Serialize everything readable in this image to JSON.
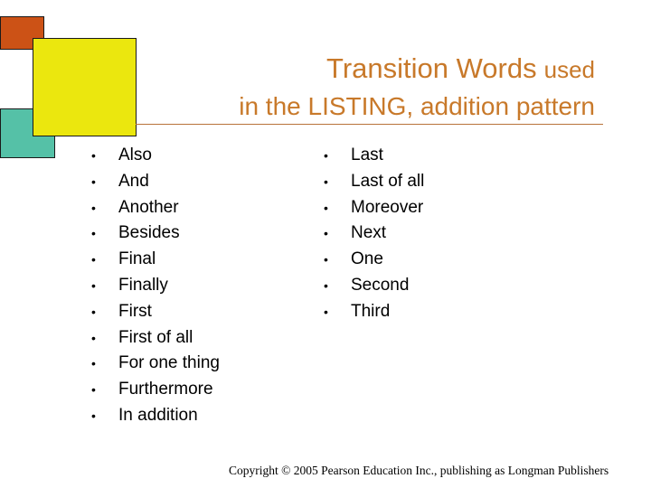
{
  "colors": {
    "orange_square": "#cc5216",
    "yellow_square": "#ebe70e",
    "teal_square": "#55c1a7",
    "title": "#c8792a",
    "rule": "#b8733a"
  },
  "title": {
    "line1_main": "Transition Words",
    "line1_suffix": "used",
    "line2": "in the LISTING, addition pattern"
  },
  "bullet_glyph": "•",
  "left_list": [
    "Also",
    "And",
    "Another",
    "Besides",
    "Final",
    "Finally",
    "First",
    "First of all",
    "For one thing",
    "Furthermore",
    "In addition"
  ],
  "right_list": [
    "Last",
    "Last of all",
    "Moreover",
    "Next",
    "One",
    "Second",
    "Third"
  ],
  "footer": "Copyright © 2005 Pearson Education Inc., publishing as Longman Publishers"
}
